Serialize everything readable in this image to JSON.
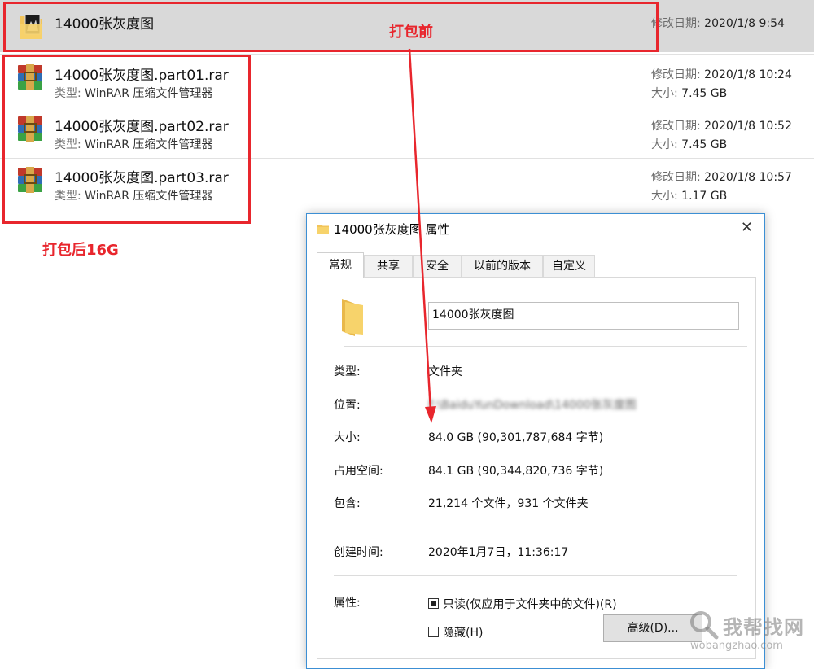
{
  "files": [
    {
      "name": "14000张灰度图",
      "type_label": "",
      "type_value": "",
      "date_label": "修改日期:",
      "date": "2020/1/8 9:54",
      "size_label": "",
      "size": ""
    },
    {
      "name": "14000张灰度图.part01.rar",
      "type_label": "类型:",
      "type_value": "WinRAR 压缩文件管理器",
      "date_label": "修改日期:",
      "date": "2020/1/8 10:24",
      "size_label": "大小:",
      "size": "7.45 GB"
    },
    {
      "name": "14000张灰度图.part02.rar",
      "type_label": "类型:",
      "type_value": "WinRAR 压缩文件管理器",
      "date_label": "修改日期:",
      "date": "2020/1/8 10:52",
      "size_label": "大小:",
      "size": "7.45 GB"
    },
    {
      "name": "14000张灰度图.part03.rar",
      "type_label": "类型:",
      "type_value": "WinRAR 压缩文件管理器",
      "date_label": "修改日期:",
      "date": "2020/1/8 10:57",
      "size_label": "大小:",
      "size": "1.17 GB"
    }
  ],
  "annotations": {
    "before": "打包前",
    "after": "打包后16G"
  },
  "dialog": {
    "title": "14000张灰度图 属性",
    "close": "✕",
    "tabs": [
      "常规",
      "共享",
      "安全",
      "以前的版本",
      "自定义"
    ],
    "folder_name": "14000张灰度图",
    "props": {
      "type_label": "类型:",
      "type_value": "文件夹",
      "location_label": "位置:",
      "location_value": "F:\\BaiduYunDownload\\14000张灰度图",
      "size_label": "大小:",
      "size_value": "84.0 GB (90,301,787,684 字节)",
      "disk_label": "占用空间:",
      "disk_value": "84.1 GB (90,344,820,736 字节)",
      "contains_label": "包含:",
      "contains_value": "21,214 个文件，931 个文件夹",
      "created_label": "创建时间:",
      "created_value": "2020年1月7日，11:36:17",
      "attr_label": "属性:",
      "readonly_label": "只读(仅应用于文件夹中的文件)(R)",
      "hidden_label": "隐藏(H)",
      "advanced_button": "高级(D)..."
    }
  },
  "watermark": {
    "main": "我帮找网",
    "sub": "wobangzhao.com"
  },
  "colors": {
    "annotation": "#e8262d",
    "selected_row": "#d9d9d9",
    "dialog_border": "#3c8fd4"
  }
}
